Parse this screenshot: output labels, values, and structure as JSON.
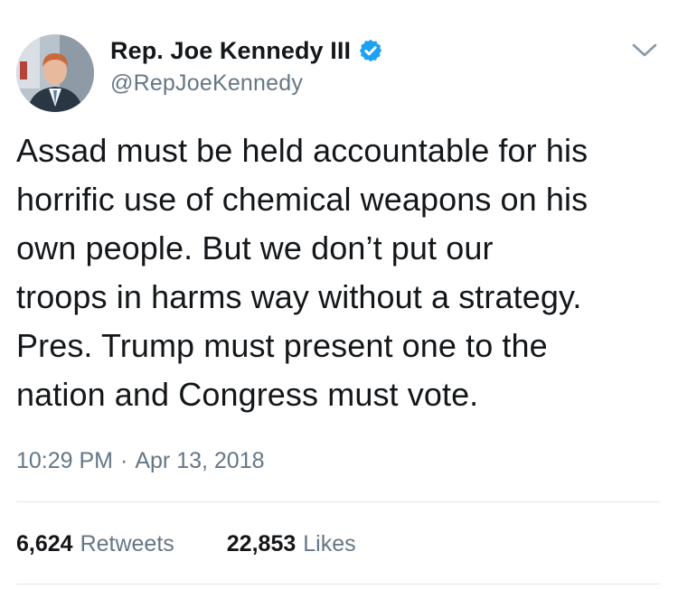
{
  "author": {
    "display_name": "Rep. Joe Kennedy III",
    "handle": "@RepJoeKennedy",
    "verified_icon": "verified-badge-icon",
    "verified_color": "#1da1f2"
  },
  "menu": {
    "icon": "chevron-down-icon"
  },
  "tweet": {
    "text": "Assad must be held accountable for his\nhorrific use of chemical weapons on his\nown people. But we don’t put our\ntroops in harms way without a strategy.\nPres. Trump must present one to the\nnation and Congress must vote."
  },
  "meta": {
    "time": "10:29 PM",
    "separator": "·",
    "date": "Apr 13, 2018"
  },
  "stats": {
    "retweets": {
      "count": "6,624",
      "label": "Retweets"
    },
    "likes": {
      "count": "22,853",
      "label": "Likes"
    }
  },
  "colors": {
    "text_primary": "#14171a",
    "text_secondary": "#657786",
    "divider": "#e1e8ed"
  }
}
